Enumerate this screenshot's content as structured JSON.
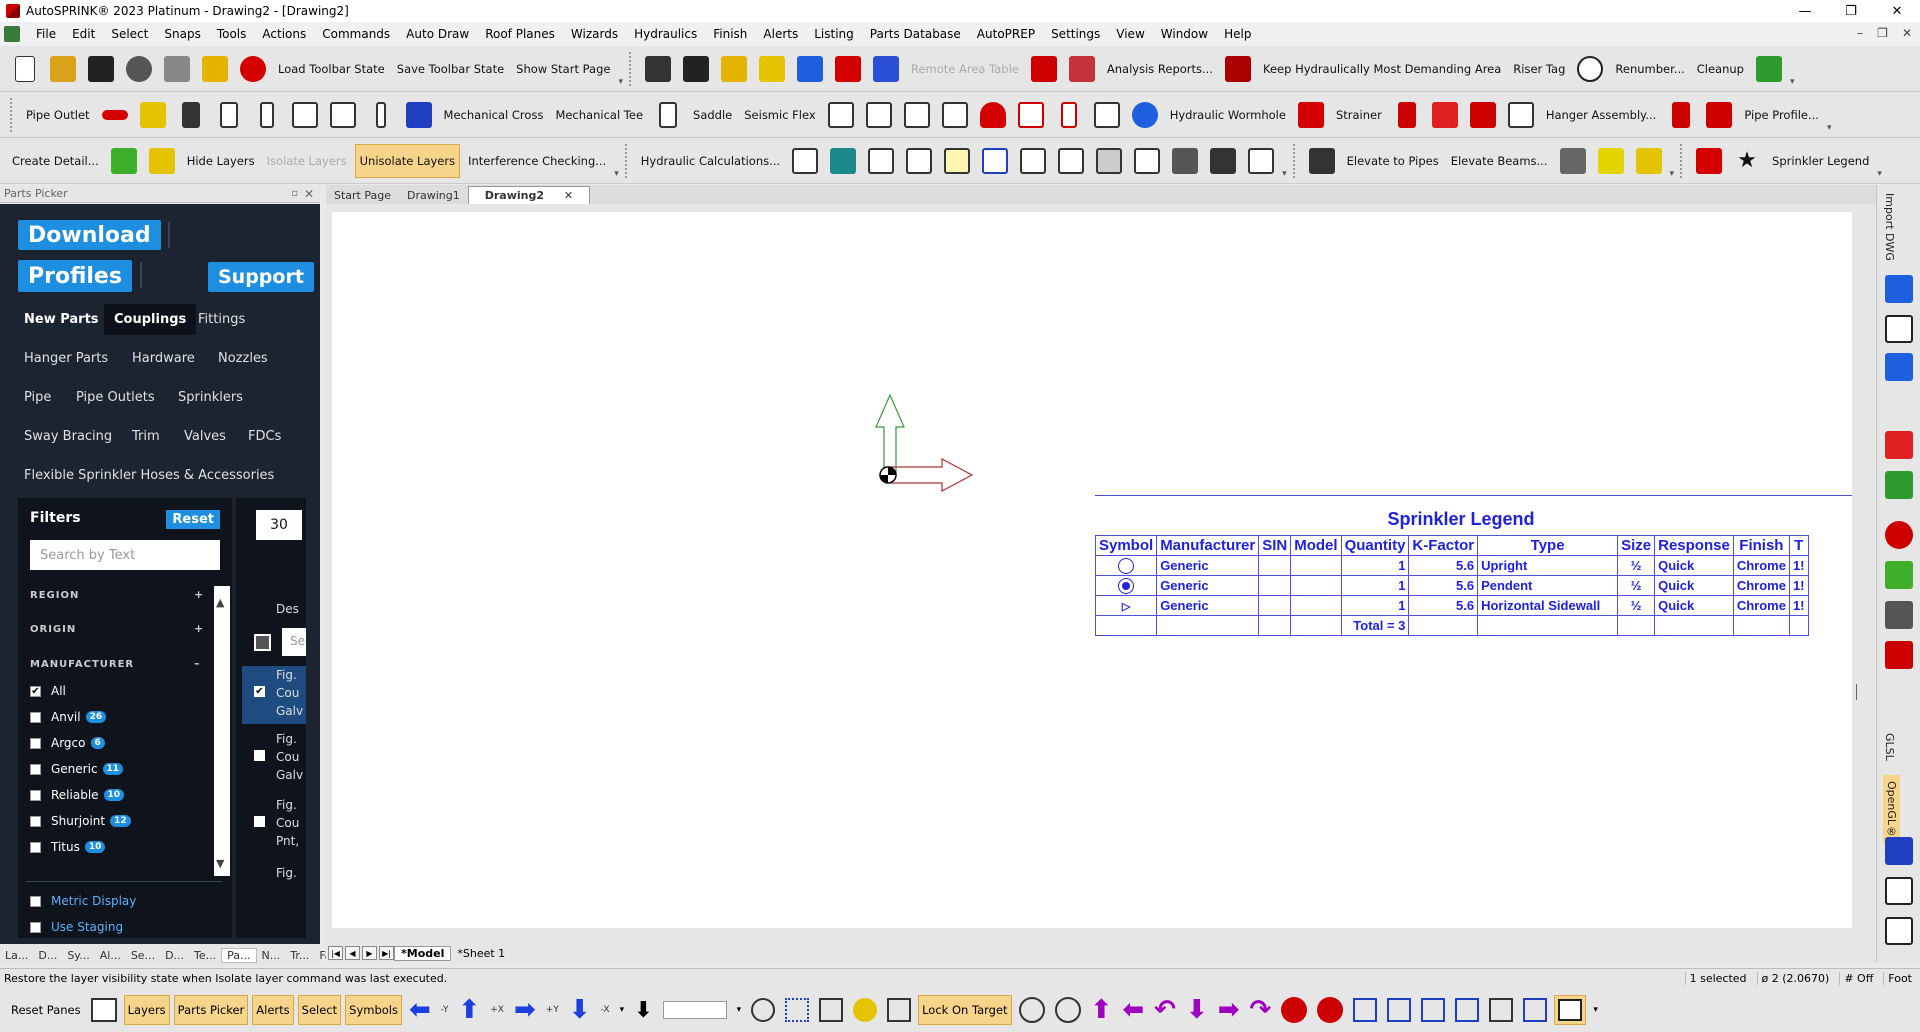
{
  "window": {
    "title": "AutoSPRINK® 2023 Platinum - Drawing2 - [Drawing2]",
    "min": "—",
    "max": "❐",
    "close": "✕"
  },
  "menu": {
    "items": [
      "File",
      "Edit",
      "Select",
      "Snaps",
      "Tools",
      "Actions",
      "Commands",
      "Auto Draw",
      "Roof Planes",
      "Wizards",
      "Hydraulics",
      "Finish",
      "Alerts",
      "Listing",
      "Parts Database",
      "AutoPREP",
      "Settings",
      "View",
      "Window",
      "Help"
    ],
    "right": [
      "–",
      "❐",
      "✕"
    ]
  },
  "toolbar1": {
    "load_toolbar_state": "Load Toolbar State",
    "save_toolbar_state": "Save Toolbar State",
    "show_start_page": "Show Start Page",
    "remote_area_table": "Remote Area Table",
    "analysis_reports": "Analysis Reports...",
    "keep_hydraulically": "Keep Hydraulically Most Demanding Area",
    "riser_tag": "Riser Tag",
    "renumber": "Renumber...",
    "cleanup": "Cleanup"
  },
  "toolbar2": {
    "pipe_outlet": "Pipe Outlet",
    "mechanical_cross": "Mechanical Cross",
    "mechanical_tee": "Mechanical Tee",
    "saddle": "Saddle",
    "seismic_flex": "Seismic Flex",
    "hydraulic_wormhole": "Hydraulic Wormhole",
    "strainer": "Strainer",
    "hanger_assembly": "Hanger Assembly...",
    "pipe_profile": "Pipe Profile..."
  },
  "toolbar3": {
    "create_detail": "Create Detail...",
    "hide_layers": "Hide Layers",
    "isolate_layers": "Isolate Layers",
    "unisolate_layers": "Unisolate Layers",
    "interference_checking": "Interference Checking...",
    "hydraulic_calculations": "Hydraulic Calculations...",
    "elevate_to_pipes": "Elevate to Pipes",
    "elevate_beams": "Elevate Beams...",
    "sprinkler_legend": "Sprinkler Legend"
  },
  "parts_picker": {
    "header": "Parts Picker",
    "pin": "▫",
    "close": "✕",
    "download": "Download",
    "profiles": "Profiles",
    "support": "Support",
    "categories": [
      "New Parts",
      "Couplings",
      "Fittings",
      "Hanger Parts",
      "Hardware",
      "Nozzles",
      "Pipe",
      "Pipe Outlets",
      "Sprinklers",
      "Sway Bracing",
      "Trim",
      "Valves",
      "FDCs",
      "Flexible Sprinkler Hoses & Accessories"
    ],
    "filters": {
      "title": "Filters",
      "reset": "Reset",
      "search_placeholder": "Search by Text",
      "region": "REGION",
      "origin": "ORIGIN",
      "manufacturer": "MANUFACTURER",
      "plus": "+",
      "minus": "–",
      "manufacturers": [
        {
          "name": "All",
          "count": "",
          "checked": true
        },
        {
          "name": "Anvil",
          "count": "26",
          "checked": false
        },
        {
          "name": "Argco",
          "count": "6",
          "checked": false
        },
        {
          "name": "Generic",
          "count": "11",
          "checked": false
        },
        {
          "name": "Reliable",
          "count": "10",
          "checked": false
        },
        {
          "name": "Shurjoint",
          "count": "12",
          "checked": false
        },
        {
          "name": "Titus",
          "count": "10",
          "checked": false
        }
      ],
      "metric_display": "Metric Display",
      "use_staging": "Use Staging",
      "scroll_up": "▲",
      "scroll_down": "▼"
    },
    "results": {
      "page_size": "30",
      "desc_header": "Des",
      "search_stub": "Se",
      "rows": [
        {
          "text": "Fig.\nCou\nGalv",
          "checked": true
        },
        {
          "text": "Fig.\nCou\nGalv",
          "checked": false
        },
        {
          "text": "Fig.\nCou\nPnt,",
          "checked": false
        },
        {
          "text": "Fig.",
          "checked": false
        }
      ]
    },
    "bottom_tabs": [
      "La...",
      "D...",
      "Sy...",
      "Al...",
      "Se...",
      "D...",
      "Te...",
      "Pa...",
      "N...",
      "Tr...",
      "Fa..."
    ]
  },
  "doc_tabs": [
    "Start Page",
    "Drawing1",
    "Drawing2"
  ],
  "doc_tab_close": "✕",
  "model_tabs": [
    "*Model",
    "*Sheet 1"
  ],
  "model_nav": [
    "|◀",
    "◀",
    "▶",
    "▶|"
  ],
  "legend": {
    "title": "Sprinkler Legend",
    "headers": [
      "Symbol",
      "Manufacturer",
      "SIN",
      "Model",
      "Quantity",
      "K-Factor",
      "Type",
      "Size",
      "Response",
      "Finish",
      "T"
    ],
    "rows": [
      {
        "symbol": "open-circle",
        "manufacturer": "Generic",
        "sin": "",
        "model": "",
        "quantity": "1",
        "kfactor": "5.6",
        "type": "Upright",
        "size": "½",
        "response": "Quick",
        "finish": "Chrome",
        "t": "1!"
      },
      {
        "symbol": "dot-circle",
        "manufacturer": "Generic",
        "sin": "",
        "model": "",
        "quantity": "1",
        "kfactor": "5.6",
        "type": "Pendent",
        "size": "½",
        "response": "Quick",
        "finish": "Chrome",
        "t": "1!"
      },
      {
        "symbol": "sidewall",
        "manufacturer": "Generic",
        "sin": "",
        "model": "",
        "quantity": "1",
        "kfactor": "5.6",
        "type": "Horizontal Sidewall",
        "size": "½",
        "response": "Quick",
        "finish": "Chrome",
        "t": "1!"
      }
    ],
    "total": "Total = 3",
    "color": "#2020e0"
  },
  "right_rail": {
    "import_dwg": "Import DWG",
    "glsl": "GLSL",
    "opengl": "OpenGL®"
  },
  "status": {
    "message": "Restore the layer visibility state when Isolate layer command was last executed.",
    "selected": "1 selected",
    "diameter": "ø 2 (2.0670)",
    "snap": "# Off",
    "units": "Foot"
  },
  "bottom_toolbar": {
    "reset_panes": "Reset Panes",
    "layers": "Layers",
    "parts_picker": "Parts Picker",
    "alerts": "Alerts",
    "select": "Select",
    "symbols": "Symbols",
    "neg_y": "-Y",
    "pos_x": "+X",
    "pos_y": "+Y",
    "neg_x": "-X",
    "lock_on_target": "Lock On Target"
  },
  "colors": {
    "accent": "#1e8fe0",
    "highlight": "#f6d48a",
    "legend": "#2020e0",
    "panel_dark": "#1c2431"
  }
}
